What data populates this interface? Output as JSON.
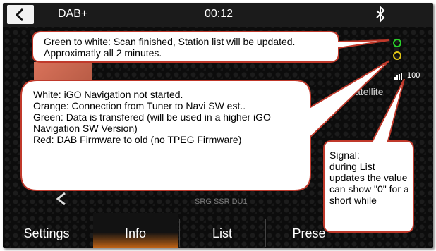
{
  "header": {
    "title": "DAB+",
    "clock": "00:12",
    "back_icon": "chevron-left-icon",
    "bluetooth_icon": "bluetooth-icon"
  },
  "station": {
    "partial_name": "g Satellite",
    "sub_text": "SRG SSR DU1"
  },
  "status": {
    "signal_value": "100",
    "indicator_top_color": "#2bd12b",
    "indicator_bottom_color": "#e0c516"
  },
  "tabs": [
    {
      "label": "Settings",
      "active": false
    },
    {
      "label": "Info",
      "active": true
    },
    {
      "label": "List",
      "active": false
    },
    {
      "label": "Prese",
      "active": false
    }
  ],
  "callouts": {
    "scan": "Green to white: Scan finished, Station list will be updated. Approximatly all 2 minutes.",
    "navi": "White: iGO Navigation not started.\nOrange: Connection from Tuner to Navi SW est..\nGreen: Data is transfered (will be used in a higher iGO Navigation SW Version)\nRed: DAB Firmware to old (no TPEG Firmware)",
    "signal": "Signal:\nduring List updates the value can show \"0\" for a short while"
  },
  "colors": {
    "accent": "#c26416",
    "callout_border": "#c0392b"
  }
}
